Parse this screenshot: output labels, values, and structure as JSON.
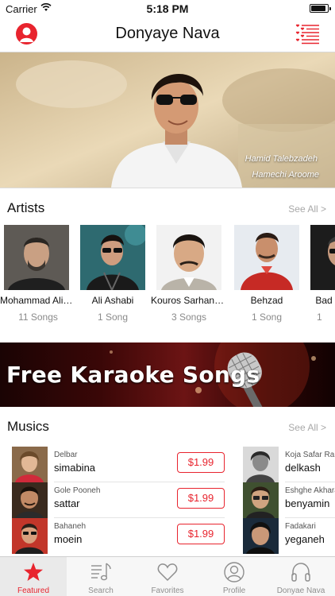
{
  "status_bar": {
    "carrier": "Carrier",
    "time": "5:18 PM",
    "battery_level": 0.9
  },
  "nav": {
    "title": "Donyaye Nava",
    "profile_icon": "person-circle-icon",
    "menu_icon": "heart-list-icon"
  },
  "hero": {
    "caption_artist": "Hamid Talebzadeh",
    "caption_song": "Hamechi Aroome"
  },
  "artists_section": {
    "heading": "Artists",
    "see_all": "See All >",
    "items": [
      {
        "name": "Mohammad Aliz…",
        "songs": "11 Songs"
      },
      {
        "name": "Ali Ashabi",
        "songs": "1 Song"
      },
      {
        "name": "Kouros Sarhang…",
        "songs": "3 Songs"
      },
      {
        "name": "Behzad",
        "songs": "1 Song"
      },
      {
        "name": "Bad",
        "songs": "1"
      }
    ]
  },
  "banner": {
    "text": "Free Karaoke Songs"
  },
  "musics_section": {
    "heading": "Musics",
    "see_all": "See All >",
    "left": [
      {
        "song": "Delbar",
        "artist": "simabina",
        "price": "$1.99"
      },
      {
        "song": "Gole Pooneh",
        "artist": "sattar",
        "price": "$1.99"
      },
      {
        "song": "Bahaneh",
        "artist": "moein",
        "price": "$1.99"
      }
    ],
    "right": [
      {
        "song": "Koja Safar Ra",
        "artist": "delkash"
      },
      {
        "song": "Eshghe Akharam",
        "artist": "benyamin"
      },
      {
        "song": "Fadakari",
        "artist": "yeganeh"
      }
    ]
  },
  "tabs": [
    {
      "label": "Featured",
      "icon": "star-icon",
      "active": true
    },
    {
      "label": "Search",
      "icon": "music-list-icon",
      "active": false
    },
    {
      "label": "Favorites",
      "icon": "heart-icon",
      "active": false
    },
    {
      "label": "Profile",
      "icon": "person-icon",
      "active": false
    },
    {
      "label": "Donyae Nava",
      "icon": "headphones-icon",
      "active": false
    }
  ],
  "colors": {
    "accent": "#e8242e",
    "muted": "#8e8e8e"
  }
}
